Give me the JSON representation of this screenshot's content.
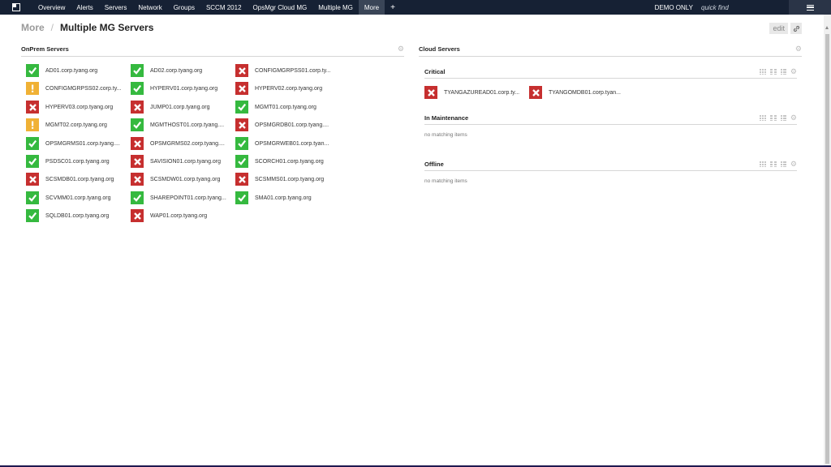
{
  "nav": {
    "items": [
      "Overview",
      "Alerts",
      "Servers",
      "Network",
      "Groups",
      "SCCM 2012",
      "OpsMgr Cloud MG",
      "Multiple MG",
      "More"
    ],
    "active": "More",
    "plus": "+",
    "demo_label": "DEMO ONLY",
    "quick_find_placeholder": "quick find"
  },
  "header": {
    "breadcrumb": "More",
    "separator": "/",
    "title": "Multiple MG Servers",
    "edit_label": "edit"
  },
  "onprem": {
    "title": "OnPrem Servers",
    "columns": [
      [
        {
          "name": "AD01.corp.tyang.org",
          "status": "ok"
        },
        {
          "name": "CONFIGMGRPSS02.corp.ty...",
          "status": "warn"
        },
        {
          "name": "HYPERV03.corp.tyang.org",
          "status": "err"
        },
        {
          "name": "MGMT02.corp.tyang.org",
          "status": "warn"
        },
        {
          "name": "OPSMGRMS01.corp.tyang....",
          "status": "ok"
        },
        {
          "name": "PSDSC01.corp.tyang.org",
          "status": "ok"
        },
        {
          "name": "SCSMDB01.corp.tyang.org",
          "status": "err"
        },
        {
          "name": "SCVMM01.corp.tyang.org",
          "status": "ok"
        },
        {
          "name": "SQLDB01.corp.tyang.org",
          "status": "ok"
        }
      ],
      [
        {
          "name": "AD02.corp.tyang.org",
          "status": "ok"
        },
        {
          "name": "HYPERV01.corp.tyang.org",
          "status": "ok"
        },
        {
          "name": "JUMP01.corp.tyang.org",
          "status": "err"
        },
        {
          "name": "MGMTHOST01.corp.tyang....",
          "status": "ok"
        },
        {
          "name": "OPSMGRMS02.corp.tyang....",
          "status": "err"
        },
        {
          "name": "SAVISION01.corp.tyang.org",
          "status": "err"
        },
        {
          "name": "SCSMDW01.corp.tyang.org",
          "status": "err"
        },
        {
          "name": "SHAREPOINT01.corp.tyang...",
          "status": "ok"
        },
        {
          "name": "WAP01.corp.tyang.org",
          "status": "err"
        }
      ],
      [
        {
          "name": "CONFIGMGRPSS01.corp.ty...",
          "status": "err"
        },
        {
          "name": "HYPERV02.corp.tyang.org",
          "status": "err"
        },
        {
          "name": "MGMT01.corp.tyang.org",
          "status": "ok"
        },
        {
          "name": "OPSMGRDB01.corp.tyang....",
          "status": "err"
        },
        {
          "name": "OPSMGRWEB01.corp.tyan...",
          "status": "ok"
        },
        {
          "name": "SCORCH01.corp.tyang.org",
          "status": "ok"
        },
        {
          "name": "SCSMMS01.corp.tyang.org",
          "status": "err"
        },
        {
          "name": "SMA01.corp.tyang.org",
          "status": "ok"
        }
      ]
    ]
  },
  "cloud": {
    "title": "Cloud Servers",
    "critical": {
      "title": "Critical",
      "items": [
        {
          "name": "TYANGAZUREAD01.corp.ty...",
          "status": "err"
        },
        {
          "name": "TYANGOMDB01.corp.tyan...",
          "status": "err"
        }
      ]
    },
    "maintenance": {
      "title": "In Maintenance",
      "empty_text": "no matching items"
    },
    "offline": {
      "title": "Offline",
      "empty_text": "no matching items"
    }
  },
  "colors": {
    "nav_bg": "#162134",
    "ok": "#35b93f",
    "err": "#c62f2f",
    "warn": "#f0b135"
  }
}
